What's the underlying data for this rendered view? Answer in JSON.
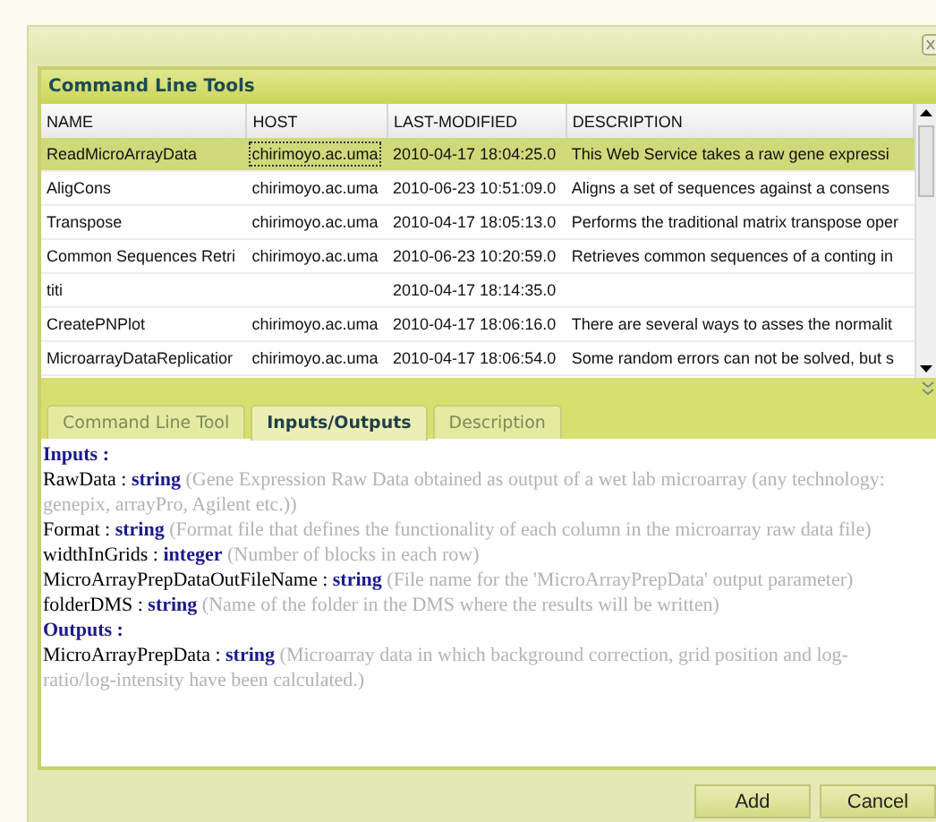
{
  "panel": {
    "title": "Command Line Tools"
  },
  "table": {
    "columns": [
      "NAME",
      "HOST",
      "LAST-MODIFIED",
      "DESCRIPTION"
    ],
    "rows": [
      {
        "cells": [
          "ReadMicroArrayData",
          "chirimoyo.ac.uma",
          "2010-04-17 18:04:25.0",
          "This Web Service takes a raw gene expressi"
        ],
        "selected": true
      },
      {
        "cells": [
          "AligCons",
          "chirimoyo.ac.uma",
          "2010-06-23 10:51:09.0",
          "Aligns a set of sequences against a consens"
        ],
        "selected": false
      },
      {
        "cells": [
          "Transpose",
          "chirimoyo.ac.uma",
          "2010-04-17 18:05:13.0",
          "Performs the traditional matrix transpose oper"
        ],
        "selected": false
      },
      {
        "cells": [
          "Common Sequences Retri",
          "chirimoyo.ac.uma",
          "2010-06-23 10:20:59.0",
          "Retrieves common sequences of a conting in"
        ],
        "selected": false
      },
      {
        "cells": [
          "titi",
          "",
          "2010-04-17 18:14:35.0",
          ""
        ],
        "selected": false
      },
      {
        "cells": [
          "CreatePNPlot",
          "chirimoyo.ac.uma",
          "2010-04-17 18:06:16.0",
          "There are several ways to asses the normalit"
        ],
        "selected": false
      },
      {
        "cells": [
          "MicroarrayDataReplicatior",
          "chirimoyo.ac.uma",
          "2010-04-17 18:06:54.0",
          "Some random errors can not be solved, but s"
        ],
        "selected": false
      }
    ]
  },
  "tabs": [
    {
      "label": "Command Line Tool",
      "selected": false
    },
    {
      "label": "Inputs/Outputs",
      "selected": true
    },
    {
      "label": "Description",
      "selected": false
    }
  ],
  "io": {
    "sections": [
      {
        "heading": "Inputs :",
        "params": [
          {
            "name": "RawData :",
            "type": "string",
            "description": "(Gene Expression Raw Data obtained as output of a wet lab microarray (any technology: genepix, arrayPro, Agilent etc.))"
          },
          {
            "name": "Format :",
            "type": "string",
            "description": "(Format file that defines the functionality of each column in the microarray raw data file)"
          },
          {
            "name": "widthInGrids :",
            "type": "integer",
            "description": "(Number of blocks in each row)"
          },
          {
            "name": "MicroArrayPrepDataOutFileName :",
            "type": "string",
            "description": "(File name for the 'MicroArrayPrepData' output parameter)"
          },
          {
            "name": "folderDMS :",
            "type": "string",
            "description": "(Name of the folder in the DMS where the results will be written)"
          }
        ]
      },
      {
        "heading": "Outputs :",
        "params": [
          {
            "name": "MicroArrayPrepData :",
            "type": "string",
            "description": "(Microarray data in which background correction, grid position and log-ratio/log-intensity have been calculated.)"
          }
        ]
      }
    ]
  },
  "buttons": [
    "Add",
    "Cancel"
  ]
}
